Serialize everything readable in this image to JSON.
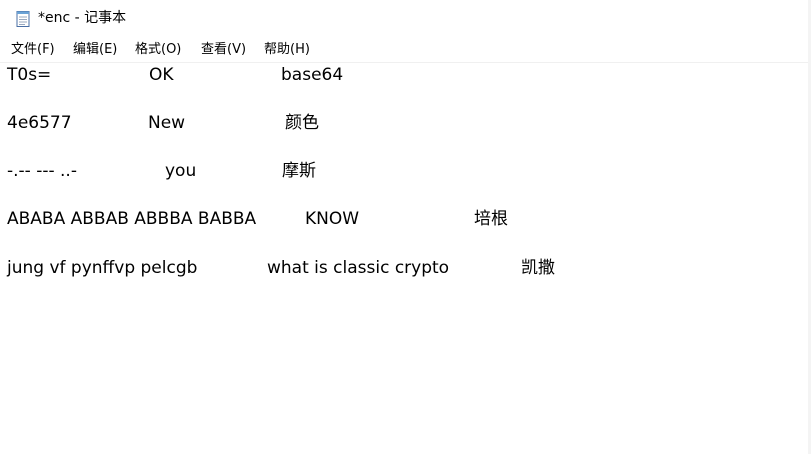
{
  "window": {
    "title": "*enc - 记事本",
    "icon": "notepad-icon"
  },
  "menu": {
    "items": [
      {
        "label": "文件(F)"
      },
      {
        "label": "编辑(E)"
      },
      {
        "label": "格式(O)"
      },
      {
        "label": "查看(V)"
      },
      {
        "label": "帮助(H)"
      }
    ]
  },
  "document": {
    "lines": [
      [
        "T0s=",
        "OK",
        "base64"
      ],
      [
        "4e6577",
        "New",
        "颜色"
      ],
      [
        "-.-- --- ..-",
        "you",
        "摩斯"
      ],
      [
        "ABABA ABBAB ABBBA BABBA",
        "KNOW",
        "培根"
      ],
      [
        "jung vf pynffvp pelcgb",
        "what is classic crypto",
        "凯撒"
      ]
    ]
  }
}
